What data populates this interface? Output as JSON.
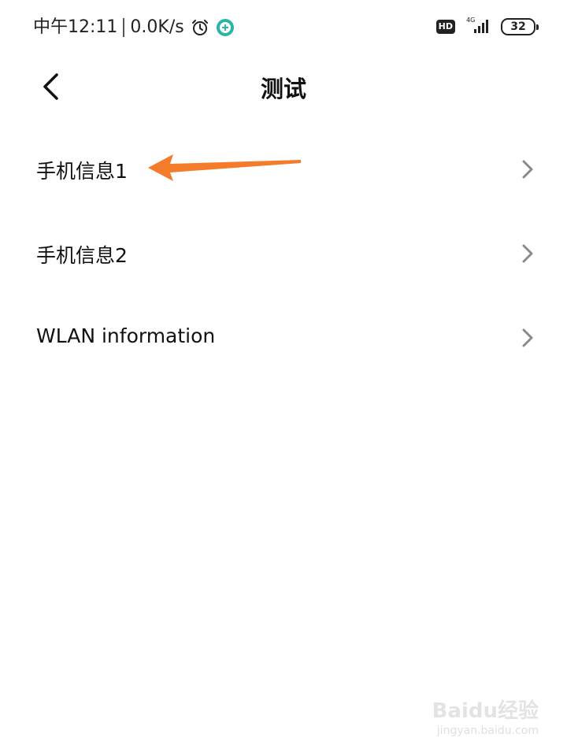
{
  "status_bar": {
    "time": "中午12:11",
    "speed": "0.0K/s",
    "hd": "HD",
    "network": "4G",
    "battery": "32",
    "icons": [
      "alarm-icon",
      "app-notification-icon",
      "hd-icon",
      "signal-icon",
      "battery-icon"
    ]
  },
  "header": {
    "title": "测试",
    "back_icon": "chevron-left-icon"
  },
  "menu": {
    "items": [
      {
        "label": "手机信息1"
      },
      {
        "label": "手机信息2"
      },
      {
        "label": "WLAN information"
      }
    ]
  },
  "annotation": {
    "color": "#F47B2A",
    "target": "手机信息1"
  },
  "watermark": {
    "brand": "Baidu经验",
    "url": "jingyan.baidu.com"
  }
}
